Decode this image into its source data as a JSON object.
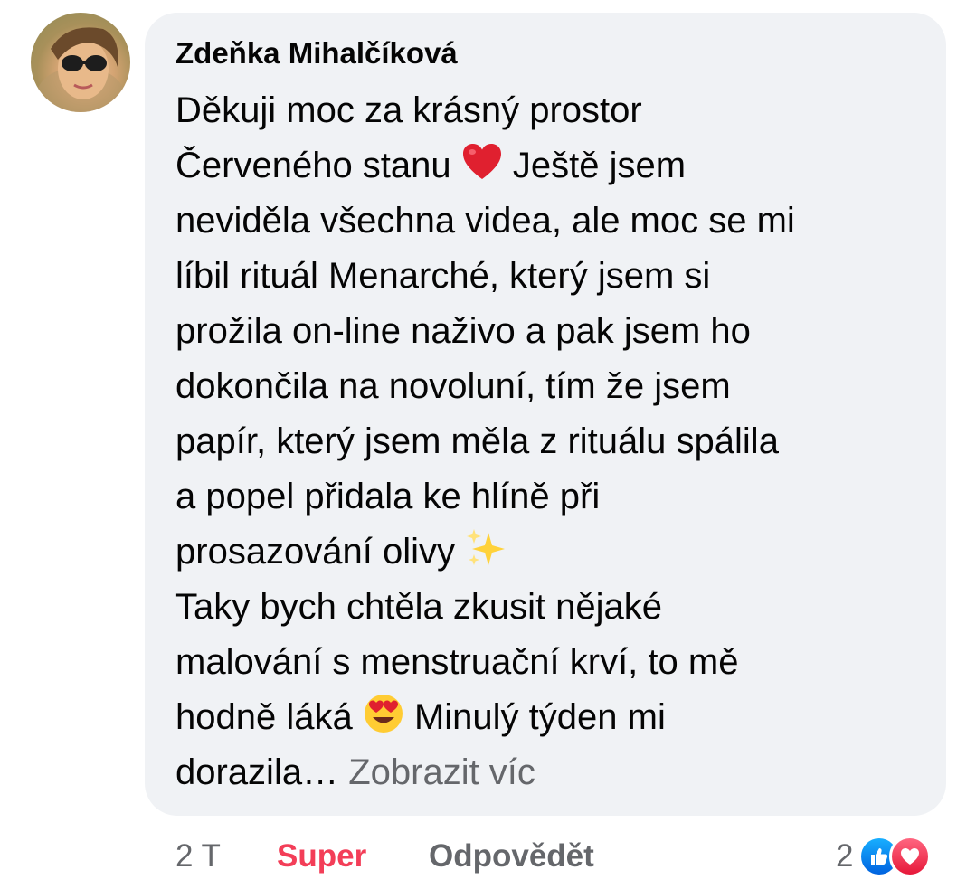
{
  "comment": {
    "author": "Zdeňka Mihalčíková",
    "lines": [
      [
        "Děkuji moc za krásný prostor"
      ],
      [
        "Červeného stanu ",
        "red-heart-emoji",
        " Ještě jsem"
      ],
      [
        "neviděla všechna videa, ale moc se mi"
      ],
      [
        "líbil rituál Menarché, který jsem si"
      ],
      [
        "prožila on-line naživo a pak jsem ho"
      ],
      [
        "dokončila na novoluní, tím že jsem"
      ],
      [
        "papír, který jsem měla z rituálu spálila"
      ],
      [
        "a popel přidala ke hlíně při"
      ],
      [
        "prosazování olivy ",
        "sparkles-emoji"
      ],
      [
        "Taky bych chtěla zkusit nějaké"
      ],
      [
        "malování s menstruační krví, to mě"
      ],
      [
        "hodně láká ",
        "heart-eyes-emoji",
        " Minulý týden mi"
      ]
    ],
    "last_line_text": "dorazila… ",
    "see_more_label": "Zobrazit víc"
  },
  "actions": {
    "time": "2 T",
    "reaction_label": "Super",
    "reply_label": "Odpovědět",
    "reaction_count": "2"
  },
  "icons": {
    "avatar": "avatar-photo",
    "reaction_1": "like-icon",
    "reaction_2": "love-icon"
  },
  "colors": {
    "bubble": "#f0f2f5",
    "text": "#050505",
    "muted": "#65676b",
    "love_accent": "#f33e58",
    "like": "#0866ff"
  }
}
